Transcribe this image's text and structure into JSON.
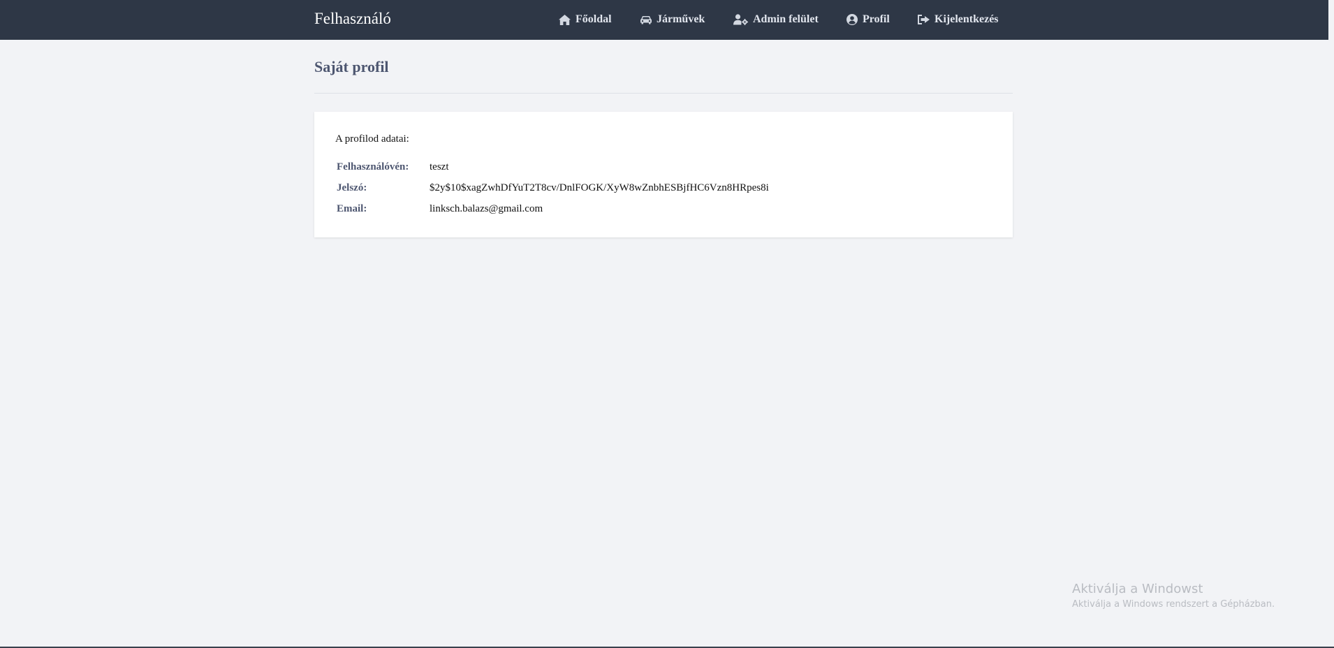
{
  "navbar": {
    "brand": "Felhasználó",
    "items": [
      {
        "label": "Főoldal",
        "icon": "home-icon"
      },
      {
        "label": "Járművek",
        "icon": "car-icon"
      },
      {
        "label": "Admin felület",
        "icon": "user-cog-icon"
      },
      {
        "label": "Profil",
        "icon": "user-circle-icon"
      },
      {
        "label": "Kijelentkezés",
        "icon": "sign-out-icon"
      }
    ]
  },
  "page": {
    "title": "Saját profil"
  },
  "profile": {
    "intro": "A profilod adatai:",
    "fields": [
      {
        "label": "Felhasználóvén:",
        "value": "teszt"
      },
      {
        "label": "Jelszó:",
        "value": "$2y$10$xagZwhDfYuT2T8cv/DnlFOGK/XyW8wZnbhESBjfHC6Vzn8HRpes8i"
      },
      {
        "label": "Email:",
        "value": "linksch.balazs@gmail.com"
      }
    ]
  },
  "watermark": {
    "title": "Aktiválja a Windowst",
    "subtitle": "Aktiválja a Windows rendszert a Gépházban."
  },
  "colors": {
    "navbar_bg": "#2e3746",
    "page_bg": "#f2f3f6",
    "label_color": "#4d5670"
  }
}
